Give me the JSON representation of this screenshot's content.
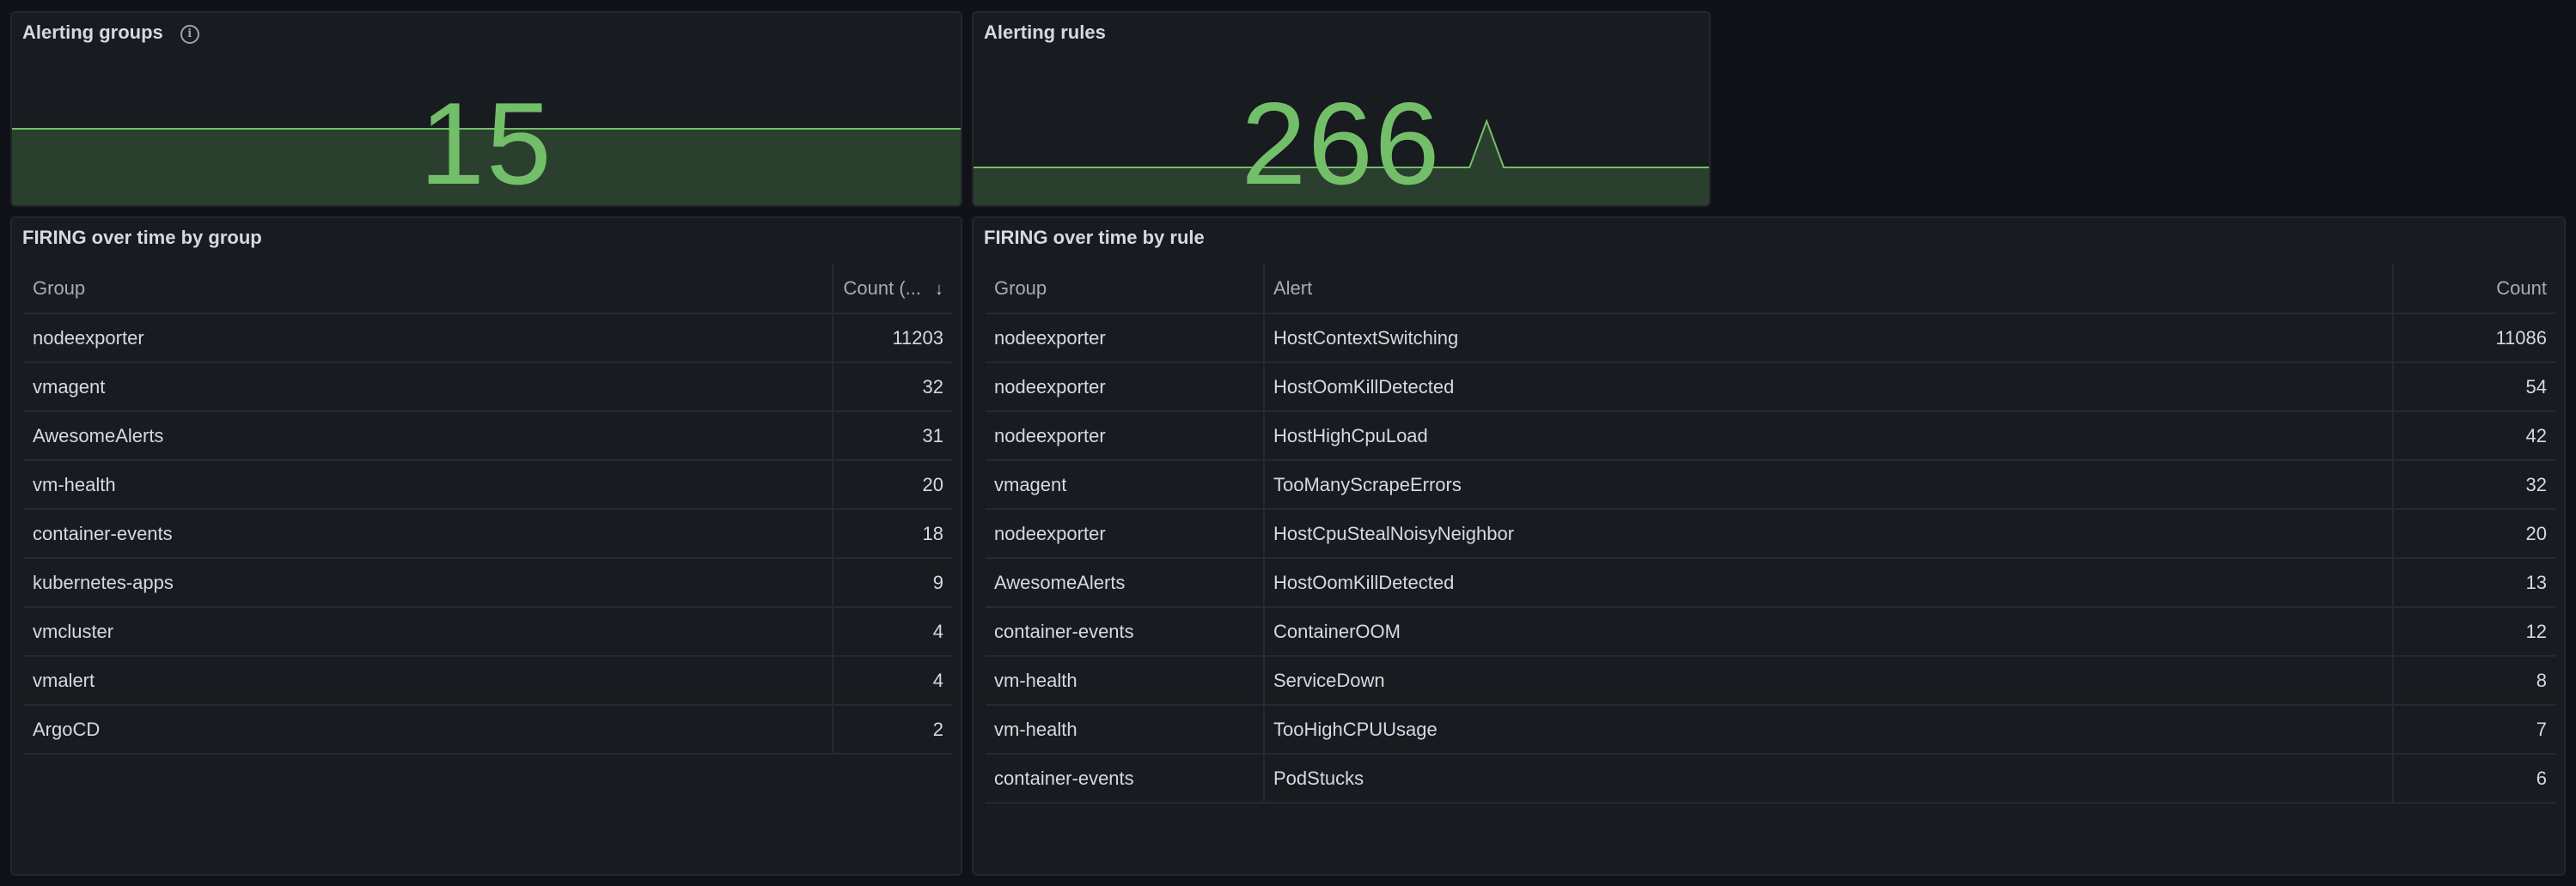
{
  "alerting_groups": {
    "title": "Alerting groups",
    "value": "15",
    "sparkline": [
      15,
      15,
      15,
      15,
      15,
      15,
      15,
      15,
      15,
      15
    ]
  },
  "alerting_rules": {
    "title": "Alerting rules",
    "value": "266",
    "sparkline": [
      266,
      266,
      266,
      266,
      266,
      266,
      266,
      266,
      266,
      266,
      266,
      266,
      266,
      266,
      266,
      266,
      266,
      266,
      266,
      266,
      266,
      266,
      266,
      266,
      266,
      266,
      266,
      266,
      266,
      266,
      300,
      266,
      266,
      266,
      266,
      266,
      266,
      266,
      266,
      266,
      266,
      266,
      266,
      266
    ]
  },
  "firing_by_group": {
    "title": "FIRING over time by group",
    "columns": [
      "Group",
      "Count (..."
    ],
    "rows": [
      {
        "group": "nodeexporter",
        "count": "11203"
      },
      {
        "group": "vmagent",
        "count": "32"
      },
      {
        "group": "AwesomeAlerts",
        "count": "31"
      },
      {
        "group": "vm-health",
        "count": "20"
      },
      {
        "group": "container-events",
        "count": "18"
      },
      {
        "group": "kubernetes-apps",
        "count": "9"
      },
      {
        "group": "vmcluster",
        "count": "4"
      },
      {
        "group": "vmalert",
        "count": "4"
      },
      {
        "group": "ArgoCD",
        "count": "2"
      }
    ]
  },
  "firing_by_rule": {
    "title": "FIRING over time by rule",
    "columns": [
      "Group",
      "Alert",
      "Count"
    ],
    "rows": [
      {
        "group": "nodeexporter",
        "alert": "HostContextSwitching",
        "count": "11086"
      },
      {
        "group": "nodeexporter",
        "alert": "HostOomKillDetected",
        "count": "54"
      },
      {
        "group": "nodeexporter",
        "alert": "HostHighCpuLoad",
        "count": "42"
      },
      {
        "group": "vmagent",
        "alert": "TooManyScrapeErrors",
        "count": "32"
      },
      {
        "group": "nodeexporter",
        "alert": "HostCpuStealNoisyNeighbor",
        "count": "20"
      },
      {
        "group": "AwesomeAlerts",
        "alert": "HostOomKillDetected",
        "count": "13"
      },
      {
        "group": "container-events",
        "alert": "ContainerOOM",
        "count": "12"
      },
      {
        "group": "vm-health",
        "alert": "ServiceDown",
        "count": "8"
      },
      {
        "group": "vm-health",
        "alert": "TooHighCPUUsage",
        "count": "7"
      },
      {
        "group": "container-events",
        "alert": "PodStucks",
        "count": "6"
      }
    ]
  },
  "colors": {
    "stat_green": "#73bf69",
    "panel_bg": "#181b1f",
    "page_bg": "#111217"
  }
}
